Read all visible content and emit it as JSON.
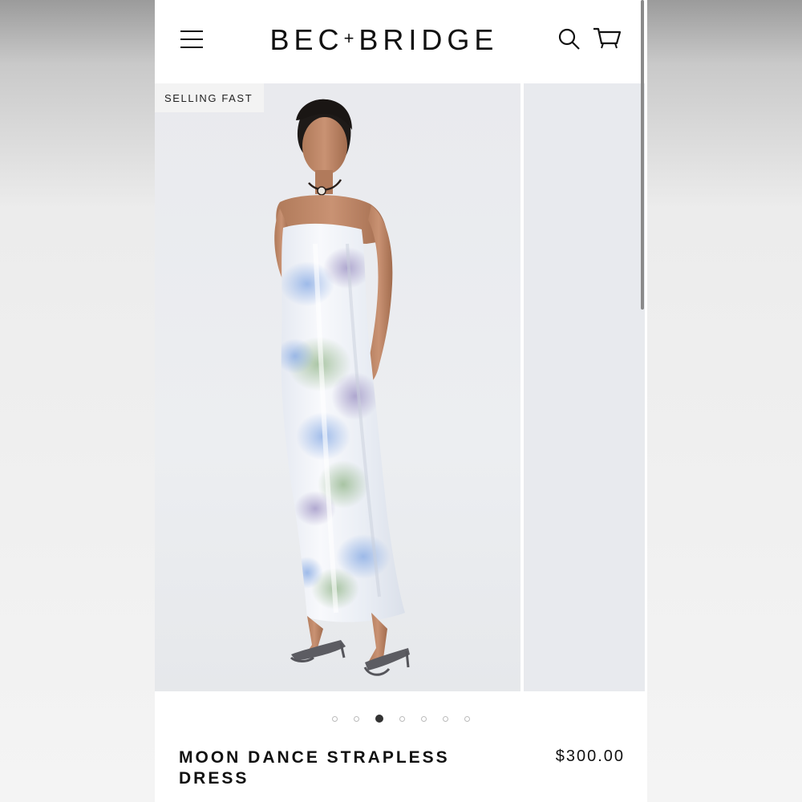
{
  "brand": {
    "left": "BEC",
    "plus": "+",
    "right": "BRIDGE"
  },
  "header": {
    "menu_icon": "hamburger-menu-icon",
    "search_icon": "search-icon",
    "cart_icon": "cart-icon"
  },
  "gallery": {
    "badge": "SELLING FAST",
    "slide_count": 7,
    "active_slide": 3
  },
  "product": {
    "title": "MOON DANCE STRAPLESS DRESS",
    "price": "$300.00"
  },
  "colors": {
    "text": "#111111",
    "background": "#ffffff",
    "image_bg": "#e9eaee",
    "badge_bg": "#f3f3f3"
  }
}
